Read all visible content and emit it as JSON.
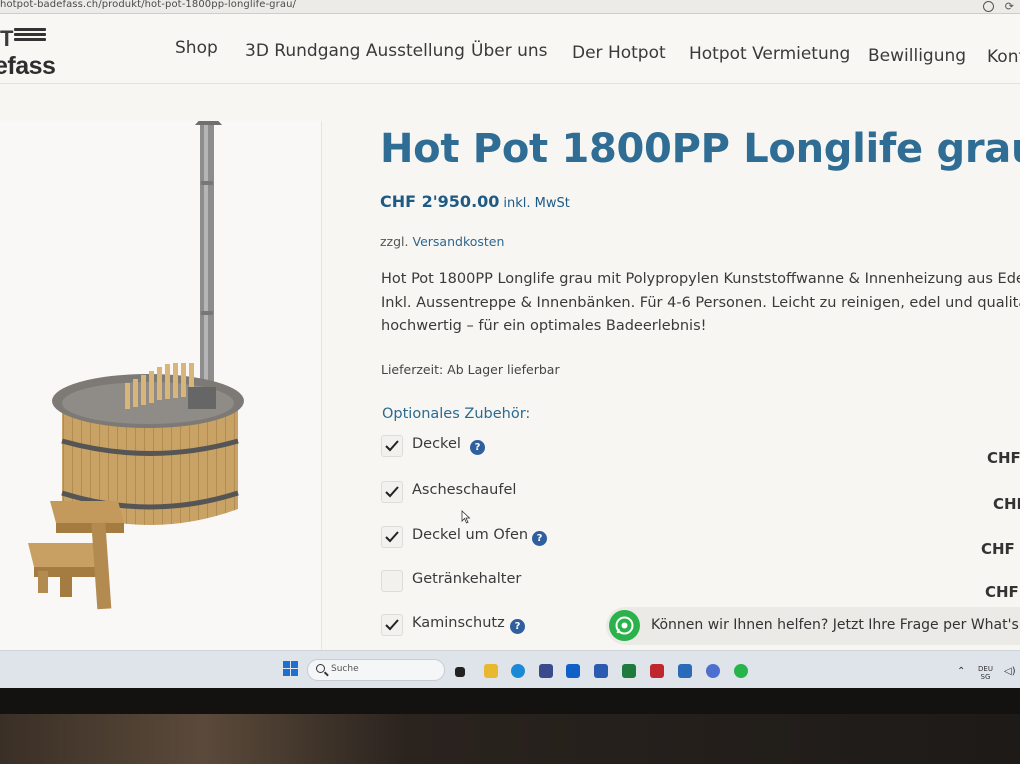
{
  "browser": {
    "url": "hotpot-badefass.ch/produkt/hot-pot-1800pp-longlife-grau/"
  },
  "site": {
    "logo_top": "T",
    "logo_word": "efass",
    "nav": [
      {
        "label": "Shop"
      },
      {
        "label": "3D Rundgang Ausstellung"
      },
      {
        "label": "Über uns"
      },
      {
        "label": "Der Hotpot"
      },
      {
        "label": "Hotpot Vermietung"
      },
      {
        "label": "Bewilligung"
      },
      {
        "label": "Kont"
      }
    ]
  },
  "product": {
    "title": "Hot Pot 1800PP Longlife grau",
    "price": "CHF 2'950.00",
    "price_tax": "inkl. MwSt",
    "shipping_prefix": "zzgl.",
    "shipping_link": "Versandkosten",
    "description_lines": [
      "Hot Pot 1800PP Longlife grau mit Polypropylen Kunststoffwanne & Innenheizung aus Edel",
      "Inkl. Aussentreppe & Innenbänken. Für 4-6 Personen. Leicht zu reinigen, edel und qualitat",
      "hochwertig – für ein optimales Badeerlebnis!"
    ],
    "delivery": "Lieferzeit: Ab Lager lieferbar",
    "optional_heading": "Optionales Zubehör:",
    "options": [
      {
        "label": "Deckel",
        "checked": true,
        "help": "?",
        "currency": "CHF"
      },
      {
        "label": "Ascheschaufel",
        "checked": true,
        "help": "",
        "currency": "CHI"
      },
      {
        "label": "Deckel um Ofen",
        "checked": true,
        "help": "?",
        "currency": "CHF"
      },
      {
        "label": "Getränkehalter",
        "checked": false,
        "help": "",
        "currency": "CHF"
      },
      {
        "label": "Kaminschutz",
        "checked": true,
        "help": "?",
        "currency": ""
      }
    ]
  },
  "chat": {
    "text": "Können wir Ihnen helfen? Jetzt Ihre Frage per What's A"
  },
  "taskbar": {
    "search_placeholder": "Suche",
    "lang_line1": "DEU",
    "lang_line2": "SG"
  },
  "colors": {
    "title_blue": "#2f6d95",
    "price_blue": "#1f5a85",
    "help_badge": "#2f5f9e",
    "whatsapp_green": "#2bb24c"
  }
}
